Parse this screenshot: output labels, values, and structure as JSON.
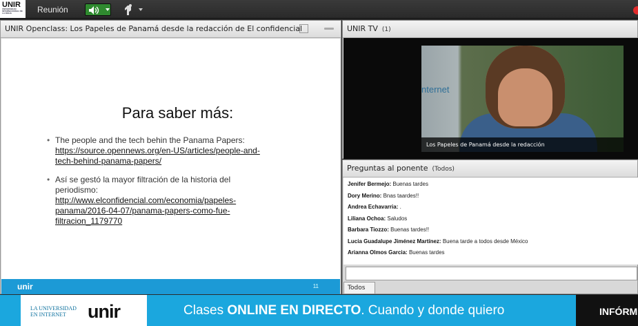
{
  "topbar": {
    "logo": "UNIR",
    "logo_sub": "UNIVERSIDAD INTERNACIONAL DE LA RIOJA",
    "menu_label": "Reunión"
  },
  "share": {
    "title": "UNIR Openclass: Los Papeles de Panamá desde la redacción de El confidencial",
    "slide": {
      "title": "Para saber más:",
      "bullet1_text": "The people and the tech behin the Panama Papers: ",
      "bullet1_link": "https://source.opennews.org/en-US/articles/people-and-tech-behind-panama-papers/",
      "bullet2_text": "Así se gestó la mayor filtración de la historia del periodismo: ",
      "bullet2_link": "http://www.elconfidencial.com/economia/papeles-panama/2016-04-07/panama-papers-como-fue-filtracion_1179770",
      "footer_brand": "unir",
      "page_number": "11"
    }
  },
  "tv": {
    "title": "UNIR TV",
    "count": "(1)",
    "sign_text": "nternet",
    "caption": "Los Papeles de Panamá desde la redacción"
  },
  "chat": {
    "title": "Preguntas al ponente",
    "scope": "(Todos)",
    "messages": [
      {
        "author": "Jenifer Bermejo:",
        "text": "Buenas tardes"
      },
      {
        "author": "Dory Merino:",
        "text": "Bnas taardes!!"
      },
      {
        "author": "Andrea Echavarria:",
        "text": "."
      },
      {
        "author": "Liliana Ochoa:",
        "text": "Saludos"
      },
      {
        "author": "Barbara  Tiozzo:",
        "text": "Buenas tardes!!"
      },
      {
        "author": "Lucia Guadalupe  Jiménez Martínez:",
        "text": "Buena tarde a todos desde México"
      },
      {
        "author": "Arianna Olmos Garcia:",
        "text": "Buenas tardes"
      }
    ],
    "recipient": "Todos"
  },
  "banner": {
    "tagline_1": "LA UNIVERSIDAD",
    "tagline_2": "EN INTERNET",
    "logo": "unir",
    "slogan_pre": "Clases ",
    "slogan_bold": "ONLINE EN DIRECTO",
    "slogan_post": ". Cuando y donde quiero",
    "cta": "INFÓRM"
  },
  "colors": {
    "banner_blue": "#1ba7de",
    "audio_green": "#2f8a2f",
    "record_red": "#e12b2b"
  },
  "icons": [
    "speaker-icon",
    "raise-hand-icon",
    "maximize-icon",
    "pod-menu-icon",
    "record-icon"
  ]
}
